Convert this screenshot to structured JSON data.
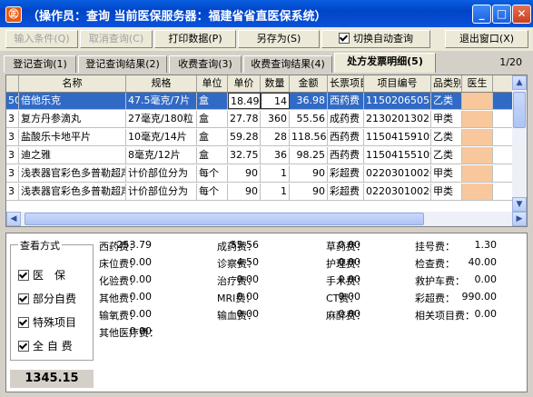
{
  "window": {
    "title": "（操作员：查询 当前医保服务器：福建省省直医保系统）",
    "app_icon_glyph": "㊣",
    "minimize_glyph": "_",
    "maximize_glyph": "□",
    "close_glyph": "✕"
  },
  "toolbar": {
    "input_conditions": "输入条件(Q)",
    "cancel_query": "取消查询(C)",
    "print": "打印数据(P)",
    "save_as": "另存为(S)",
    "auto_query": "切换自动查询",
    "exit": "退出窗口(X)"
  },
  "tabs": [
    "登记查询(1)",
    "登记查询结果(2)",
    "收费查询(3)",
    "收费查询结果(4)",
    "处方发票明细(5)"
  ],
  "page_count": "1/20",
  "grid": {
    "headers": [
      "",
      "名称",
      "规格",
      "单位",
      "单价",
      "数量",
      "金额",
      "长票项目",
      "项目编号",
      "品类别",
      "医生"
    ],
    "rows": [
      [
        "50",
        "倍他乐克",
        "47.5毫克/7片",
        "盒",
        "18.49",
        "14",
        "36.98",
        "西药费",
        "11502065058000",
        "乙类",
        ""
      ],
      [
        "3",
        "复方丹参滴丸",
        "27毫克/180粒",
        "盒",
        "27.78",
        "360",
        "55.56",
        "成药费",
        "21302013022624",
        "甲类",
        ""
      ],
      [
        "3",
        "盐酸乐卡地平片",
        "10毫克/14片",
        "盒",
        "59.28",
        "28",
        "118.56",
        "西药费",
        "11504159109163",
        "乙类",
        ""
      ],
      [
        "3",
        "迪之雅",
        "8毫克/12片",
        "盒",
        "32.75",
        "36",
        "98.25",
        "西药费",
        "11504155109064",
        "乙类",
        ""
      ],
      [
        "3",
        "浅表器官彩色多普勒超声",
        "计价部位分为",
        "每个",
        "90",
        "1",
        "90",
        "彩超费",
        "022030100200",
        "甲类",
        ""
      ],
      [
        "3",
        "浅表器官彩色多普勒超声",
        "计价部位分为",
        "每个",
        "90",
        "1",
        "90",
        "彩超费",
        "022030100200",
        "甲类",
        ""
      ]
    ]
  },
  "view_mode": {
    "title": "查看方式",
    "options": [
      "医　保",
      "部分自费",
      "特殊项目",
      "全 自 费"
    ]
  },
  "total": "1345.15",
  "fees": [
    [
      "西药费：",
      "253.79",
      "成药费：",
      "55.56",
      "草药费：",
      "0.00",
      "挂号费：",
      "1.30"
    ],
    [
      "床位费：",
      "0.00",
      "诊察费：",
      "4.50",
      "护理费：",
      "0.00",
      "检查费：",
      "40.00"
    ],
    [
      "化验费：",
      "0.00",
      "治疗费：",
      "0.00",
      "手术费：",
      "0.00",
      "救护车费：",
      "0.00"
    ],
    [
      "其他费：",
      "0.00",
      "MRI费：",
      "0.00",
      "CT费：",
      "0.00",
      "彩超费：",
      "990.00"
    ],
    [
      "输氧费：",
      "0.00",
      "输血费：",
      "0.00",
      "麻醉费：",
      "0.00",
      "相关项目费：",
      "0.00"
    ],
    [
      "其他医疗费：",
      "0.00"
    ]
  ]
}
